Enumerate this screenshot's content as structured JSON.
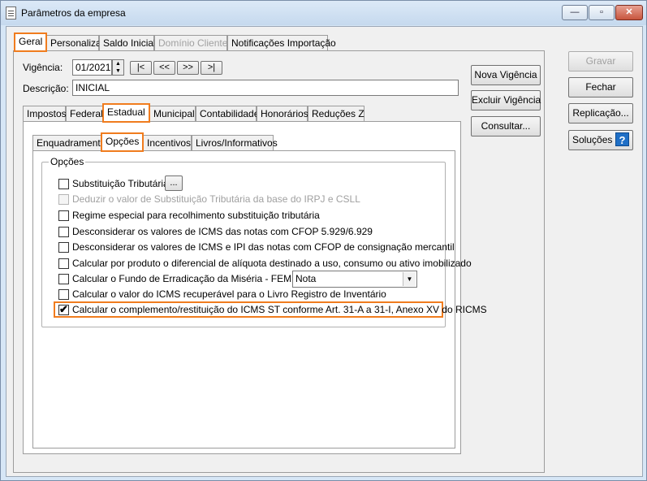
{
  "window": {
    "title": "Parâmetros da empresa",
    "controls": {
      "minimize": "—",
      "maximize": "▫",
      "close": "✕"
    }
  },
  "top_tabs": [
    {
      "label": "Geral",
      "active": true
    },
    {
      "label": "Personaliza"
    },
    {
      "label": "Saldo Inicial"
    },
    {
      "label": "Domínio Cliente",
      "disabled": true
    },
    {
      "label": "Notificações Importação"
    }
  ],
  "form": {
    "vigencia_label": "Vigência:",
    "vigencia_value": "01/2021",
    "descricao_label": "Descrição:",
    "descricao_value": "INICIAL",
    "nav": [
      "|<",
      "<<",
      ">>",
      ">|"
    ]
  },
  "side_buttons": {
    "nova_vigencia": "Nova Vigência",
    "excluir_vigencia": "Excluir Vigência",
    "consultar": "Consultar..."
  },
  "right_buttons": {
    "gravar": "Gravar",
    "fechar": "Fechar",
    "replicacao": "Replicação...",
    "solucoes": "Soluções",
    "help": "?"
  },
  "mid_tabs": [
    {
      "label": "Impostos"
    },
    {
      "label": "Federal"
    },
    {
      "label": "Estadual",
      "active": true
    },
    {
      "label": "Municipal"
    },
    {
      "label": "Contabilidade"
    },
    {
      "label": "Honorários"
    },
    {
      "label": "Reduções Z"
    }
  ],
  "inner_tabs": [
    {
      "label": "Enquadramento"
    },
    {
      "label": "Opções",
      "active": true
    },
    {
      "label": "Incentivos"
    },
    {
      "label": "Livros/Informativos"
    }
  ],
  "options_group": {
    "title": "Opções",
    "items": [
      {
        "label": "Substituição Tributária",
        "checked": false
      },
      {
        "label": "Deduzir o valor de Substituição Tributária da base do IRPJ e CSLL",
        "checked": false,
        "disabled": true
      },
      {
        "label": "Regime especial para recolhimento substituição tributária",
        "checked": false
      },
      {
        "label": "Desconsiderar os valores de ICMS das notas com CFOP 5.929/6.929",
        "checked": false
      },
      {
        "label": "Desconsiderar os valores de ICMS e IPI das notas com CFOP de consignação mercantil",
        "checked": false
      },
      {
        "label": "Calcular por produto o diferencial de alíquota destinado a uso, consumo ou ativo imobilizado",
        "checked": false
      },
      {
        "label": "Calcular o Fundo de Erradicação da Miséria - FEM por:",
        "checked": false
      },
      {
        "label": "Calcular o valor do ICMS recuperável para o Livro Registro de Inventário",
        "checked": false
      },
      {
        "label": "Calcular o complemento/restituição do ICMS ST conforme Art. 31-A a 31-I, Anexo XV do RICMS",
        "checked": true
      }
    ],
    "ellipsis": "...",
    "fem_select": "Nota"
  }
}
